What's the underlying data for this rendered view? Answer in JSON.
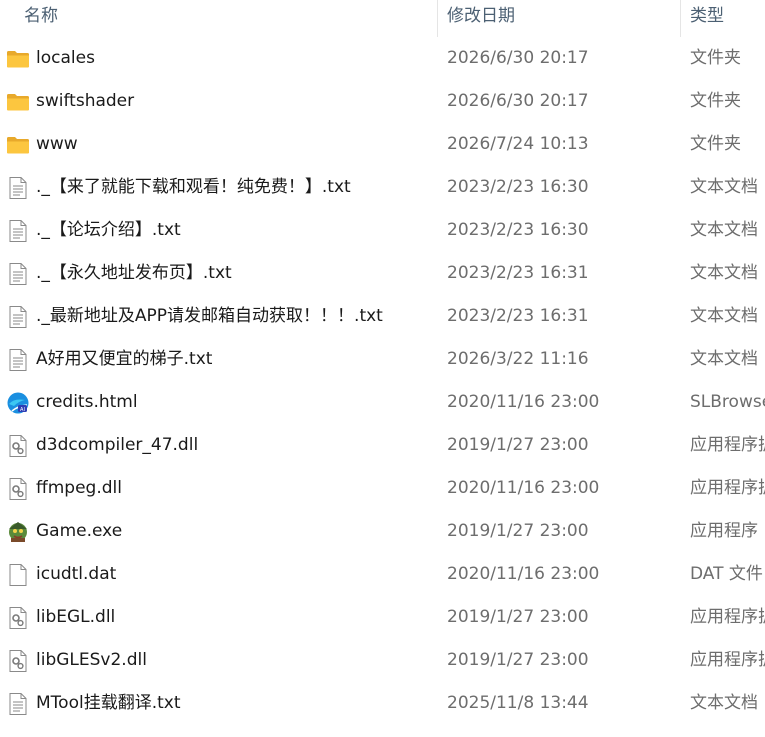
{
  "columns": {
    "name": "名称",
    "date": "修改日期",
    "type": "类型"
  },
  "files": [
    {
      "name": "locales",
      "date": "2026/6/30 20:17",
      "type": "文件夹",
      "icon": "folder-icon"
    },
    {
      "name": "swiftshader",
      "date": "2026/6/30 20:17",
      "type": "文件夹",
      "icon": "folder-icon"
    },
    {
      "name": "www",
      "date": "2026/7/24 10:13",
      "type": "文件夹",
      "icon": "folder-icon"
    },
    {
      "name": "._【来了就能下载和观看！纯免费！】.txt",
      "date": "2023/2/23 16:30",
      "type": "文本文档",
      "icon": "text-file-icon"
    },
    {
      "name": "._【论坛介绍】.txt",
      "date": "2023/2/23 16:30",
      "type": "文本文档",
      "icon": "text-file-icon"
    },
    {
      "name": "._【永久地址发布页】.txt",
      "date": "2023/2/23 16:31",
      "type": "文本文档",
      "icon": "text-file-icon"
    },
    {
      "name": "._最新地址及APP请发邮箱自动获取！！！.txt",
      "date": "2023/2/23 16:31",
      "type": "文本文档",
      "icon": "text-file-icon"
    },
    {
      "name": "A好用又便宜的梯子.txt",
      "date": "2026/3/22 11:16",
      "type": "文本文档",
      "icon": "text-file-icon"
    },
    {
      "name": "credits.html",
      "date": "2020/11/16 23:00",
      "type": "SLBrowser",
      "icon": "browser-html-icon"
    },
    {
      "name": "d3dcompiler_47.dll",
      "date": "2019/1/27 23:00",
      "type": "应用程序扩展",
      "icon": "dll-file-icon"
    },
    {
      "name": "ffmpeg.dll",
      "date": "2020/11/16 23:00",
      "type": "应用程序扩展",
      "icon": "dll-file-icon"
    },
    {
      "name": "Game.exe",
      "date": "2019/1/27 23:00",
      "type": "应用程序",
      "icon": "game-exe-icon"
    },
    {
      "name": "icudtl.dat",
      "date": "2020/11/16 23:00",
      "type": "DAT 文件",
      "icon": "blank-file-icon"
    },
    {
      "name": "libEGL.dll",
      "date": "2019/1/27 23:00",
      "type": "应用程序扩展",
      "icon": "dll-file-icon"
    },
    {
      "name": "libGLESv2.dll",
      "date": "2019/1/27 23:00",
      "type": "应用程序扩展",
      "icon": "dll-file-icon"
    },
    {
      "name": "MTool挂载翻译.txt",
      "date": "2025/11/8 13:44",
      "type": "文本文档",
      "icon": "text-file-icon"
    }
  ]
}
